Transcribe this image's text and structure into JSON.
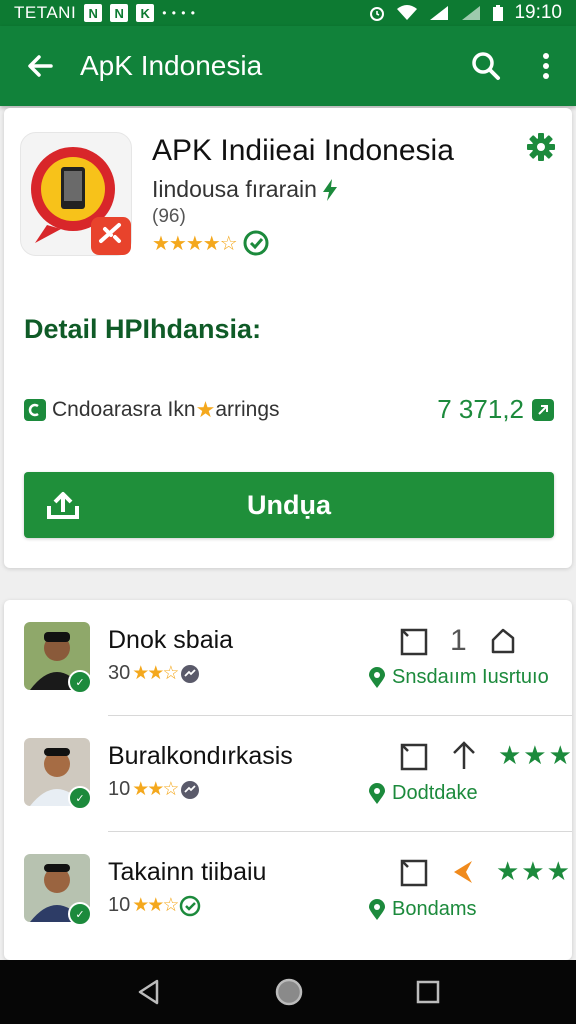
{
  "status_bar": {
    "carrier": "TETANI",
    "icons": [
      "N",
      "N",
      "K"
    ],
    "time": "19:10"
  },
  "app_bar": {
    "title": "ApK Indonesia"
  },
  "app": {
    "title": "APK Indiieai Indonesia",
    "subtitle": "Iindousa  fırarain",
    "size": "(96)",
    "rating_stars": "★★★★☆"
  },
  "details": {
    "heading": "Detail HPIhdansia:",
    "stat_label": "Cndoarasra Ikn",
    "stat_label2": "arrings",
    "stat_value": "7 371,2",
    "button_label": "Undụa"
  },
  "reviews": [
    {
      "name": "Dnok sbaia",
      "count": "30",
      "stars": "★★☆",
      "action_num": "1",
      "location": "Snsdaıım Iusrtuıo"
    },
    {
      "name": "Buralkondırkasis",
      "count": "10",
      "stars": "★★☆",
      "action_num": "",
      "location": "Dodtdake"
    },
    {
      "name": "Takainn tiibaiu",
      "count": "10",
      "stars": "★★☆",
      "action_num": "",
      "location": "Bondams"
    }
  ],
  "colors": {
    "primary": "#11823a",
    "accent": "#1c8a3c",
    "star": "#f4a81d"
  }
}
